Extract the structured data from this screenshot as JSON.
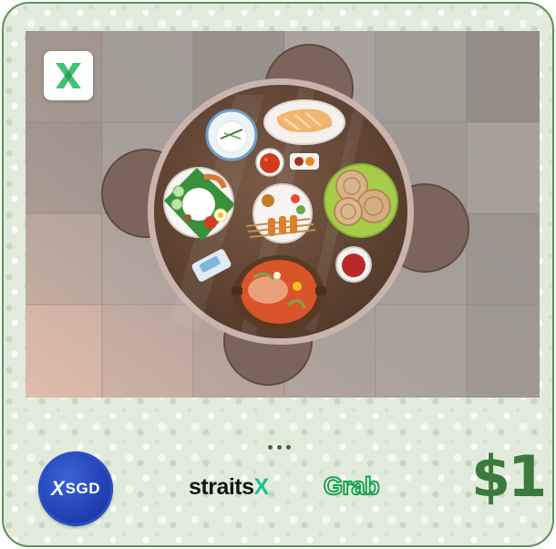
{
  "colors": {
    "frame_border": "#5f8f5a",
    "xsgd_blue": "#1d3cae",
    "straitsx_accent": "#1ec28b",
    "grab_green": "#1aa250",
    "dollar_green": "#3b7a3c"
  },
  "icons": {
    "top_logo": "straitsx-x-logo-icon",
    "carousel": "ellipsis-dots-icon"
  },
  "partners": {
    "token": {
      "x_mark": "X",
      "label": "SGD"
    },
    "straitsx": {
      "main": "straits",
      "accent": "X"
    },
    "grab": {
      "label": "Grab"
    }
  },
  "price": {
    "label": "$1"
  }
}
